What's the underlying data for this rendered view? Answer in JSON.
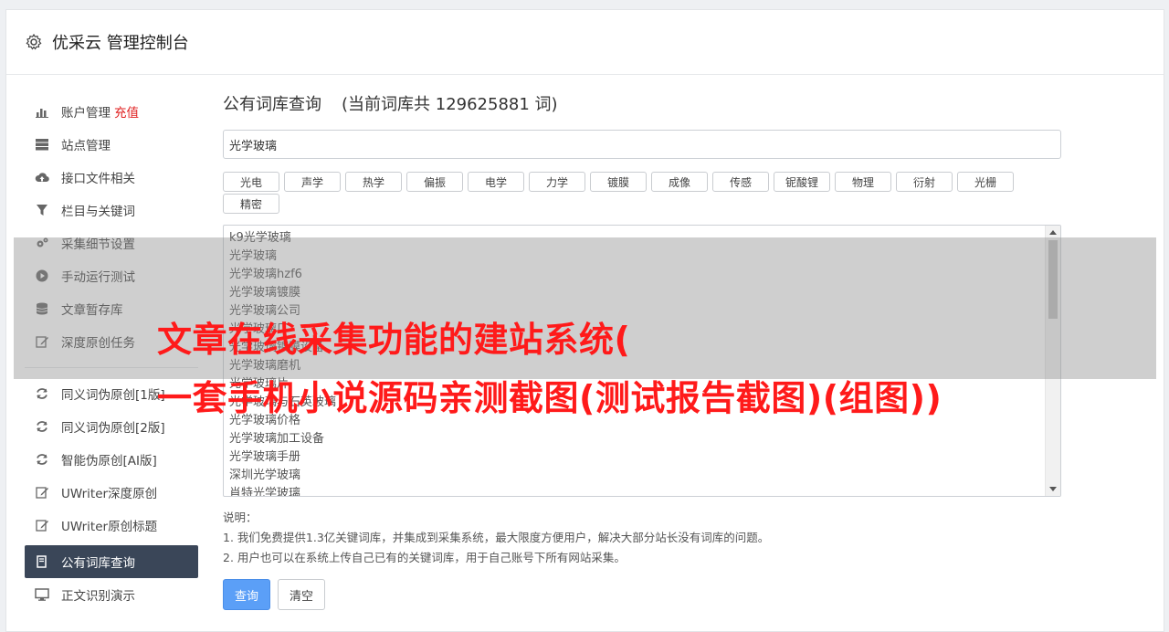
{
  "header": {
    "title": "优采云 管理控制台",
    "icon": "gear-icon"
  },
  "sidebar": {
    "items_top": [
      {
        "label": "账户管理",
        "badge": "充值",
        "icon": "bar-chart-icon"
      },
      {
        "label": "站点管理",
        "icon": "server-icon"
      },
      {
        "label": "接口文件相关",
        "icon": "cloud-upload-icon"
      },
      {
        "label": "栏目与关键词",
        "icon": "filter-icon"
      },
      {
        "label": "采集细节设置",
        "icon": "cogs-icon"
      },
      {
        "label": "手动运行测试",
        "icon": "play-circle-icon"
      },
      {
        "label": "文章暂存库",
        "icon": "database-icon"
      },
      {
        "label": "深度原创任务",
        "icon": "edit-icon"
      }
    ],
    "items_bottom": [
      {
        "label": "同义词伪原创[1版]",
        "icon": "refresh-icon"
      },
      {
        "label": "同义词伪原创[2版]",
        "icon": "refresh-icon"
      },
      {
        "label": "智能伪原创[AI版]",
        "icon": "refresh-icon"
      },
      {
        "label": "UWriter深度原创",
        "icon": "edit-icon"
      },
      {
        "label": "UWriter原创标题",
        "icon": "edit-icon"
      },
      {
        "label": "公有词库查询",
        "icon": "book-icon",
        "active": true
      },
      {
        "label": "正文识别演示",
        "icon": "monitor-icon"
      }
    ]
  },
  "main": {
    "title": "公有词库查询",
    "count_text": "(当前词库共 129625881 词)",
    "query_value": "光学玻璃",
    "tags": [
      "光电",
      "声学",
      "热学",
      "偏振",
      "电学",
      "力学",
      "镀膜",
      "成像",
      "传感",
      "铌酸锂",
      "物理",
      "衍射",
      "光栅",
      "精密"
    ],
    "results": [
      "k9光学玻璃",
      "光学玻璃",
      "光学玻璃hzf6",
      "光学玻璃镀膜",
      "光学玻璃公司",
      "光学玻璃厂",
      "光学玻璃镀膜设备",
      "光学玻璃磨机",
      "光学玻璃片",
      "光学玻璃与石英玻璃",
      "光学玻璃价格",
      "光学玻璃加工设备",
      "光学玻璃手册",
      "深圳光学玻璃",
      "肖特光学玻璃"
    ],
    "notes_title": "说明：",
    "notes": [
      "1. 我们免费提供1.3亿关键词库，并集成到采集系统，最大限度方便用户，解决大部分站长没有词库的问题。",
      "2. 用户也可以在系统上传自己已有的关键词库，用于自己账号下所有网站采集。"
    ],
    "query_button": "查询",
    "clear_button": "清空"
  },
  "overlay": {
    "line1": "文章在线采集功能的建站系统(",
    "line2": "一套手机小说源码亲测截图(测试报告截图)(组图))"
  },
  "colors": {
    "active_bg": "#3a4658",
    "primary": "#5b9ff7",
    "badge": "#e02020",
    "overlay_text": "#ff1a1a"
  }
}
